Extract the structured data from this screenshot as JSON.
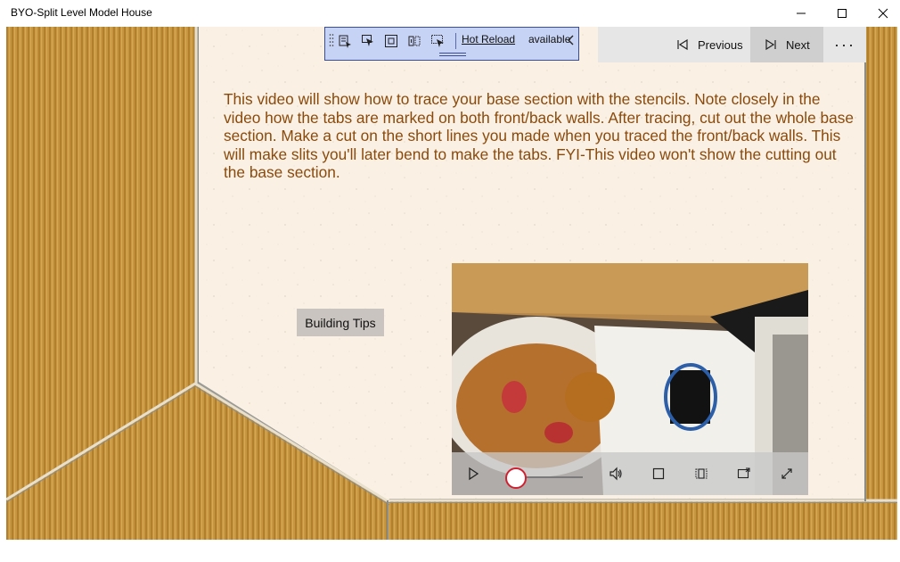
{
  "window": {
    "title": "BYO-Split Level Model House"
  },
  "hot_reload": {
    "link_label": "Hot Reload",
    "status": "available"
  },
  "command_bar": {
    "previous_label": "Previous",
    "next_label": "Next",
    "more_label": "···"
  },
  "content": {
    "description": "This video will show how to trace your base section with the stencils. Note closely in the video how the tabs are marked on both front/back walls. After tracing, cut out the whole base section. Make a cut on the short lines you made when you traced the front/back walls. This will make slits you'll later bend to make the tabs. FYI-This video won't show the cutting out the base section.",
    "tips_button_label": "Building Tips"
  },
  "video": {
    "progress": 0.0
  }
}
